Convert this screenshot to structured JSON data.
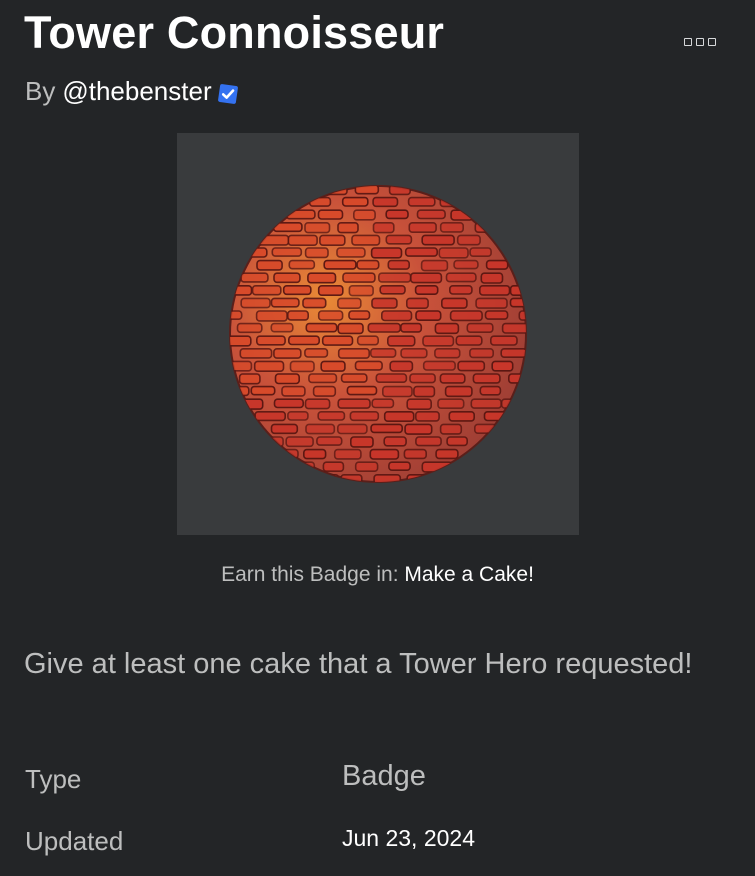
{
  "badge": {
    "title": "Tower Connoisseur",
    "by_label": "By",
    "creator": "@thebenster",
    "creator_verified": true,
    "image_name": "brick-sphere-badge",
    "earn_prefix": "Earn this Badge in: ",
    "place_name": "Make a Cake!",
    "description": "Give at least one cake that a Tower Hero requested!"
  },
  "details": {
    "type_label": "Type",
    "type_value": "Badge",
    "updated_label": "Updated",
    "updated_value": "Jun 23, 2024"
  },
  "icons": {
    "more": "more-options-icon",
    "verified": "verified-badge-icon"
  },
  "colors": {
    "background": "#232527",
    "thumbnail_background": "#393b3d",
    "secondary_text": "#bdbebe",
    "primary_text": "#ffffff",
    "verified_blue": "#3472f0"
  }
}
